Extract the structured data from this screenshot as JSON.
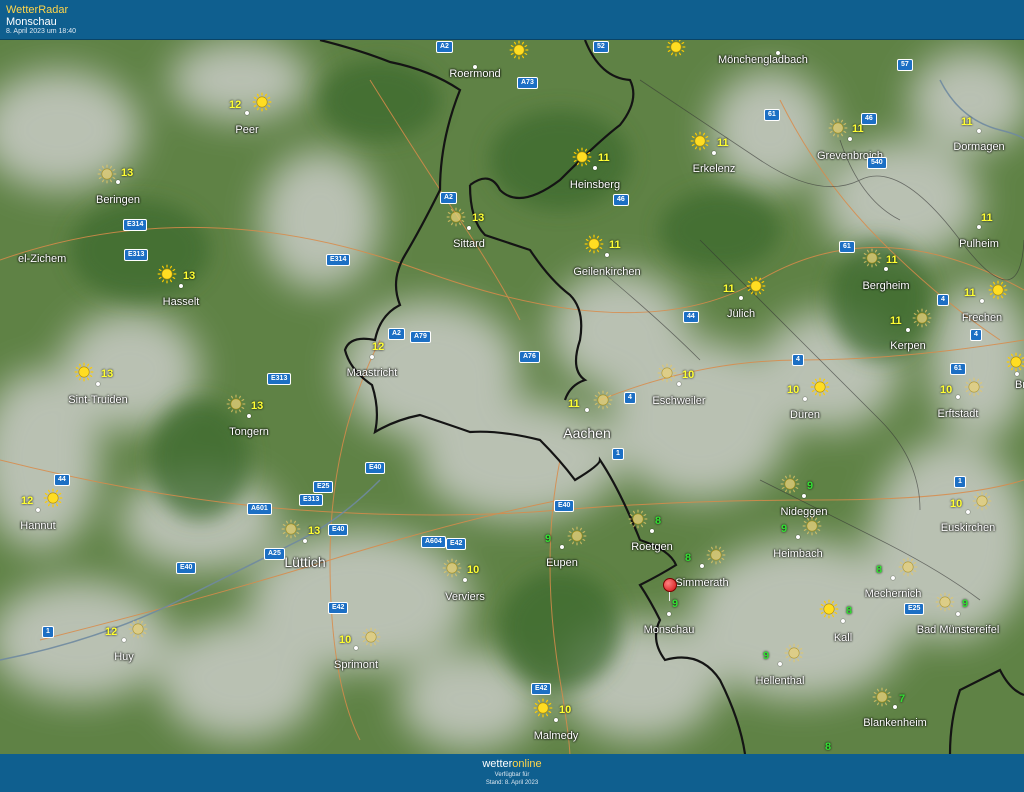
{
  "header": {
    "brand": "WetterRadar",
    "location": "Monschau",
    "timestamp": "8. April 2023 um 18:40"
  },
  "map": {
    "cities": [
      {
        "name": "Roermond",
        "temp": "",
        "weather": "sunny",
        "color": "#ffff33"
      },
      {
        "name": "Mönchengladbach",
        "temp": "",
        "weather": "sunny",
        "color": "#ffff33"
      },
      {
        "name": "Peer",
        "temp": "12",
        "weather": "sunny",
        "color": "#ffff33"
      },
      {
        "name": "Beringen",
        "temp": "13",
        "weather": "sunny-hazy",
        "color": "#ffff33"
      },
      {
        "name": "Sittard",
        "temp": "13",
        "weather": "sunny-hazy",
        "color": "#ffff33"
      },
      {
        "name": "Heinsberg",
        "temp": "11",
        "weather": "sunny",
        "color": "#ffff33"
      },
      {
        "name": "Erkelenz",
        "temp": "11",
        "weather": "sunny",
        "color": "#ffff33"
      },
      {
        "name": "Grevenbroich",
        "temp": "11",
        "weather": "sunny-hazy",
        "color": "#ffff33"
      },
      {
        "name": "Dormagen",
        "temp": "11",
        "weather": "",
        "color": "#ffff33"
      },
      {
        "name": "el-Zichem",
        "temp": "",
        "weather": "",
        "color": "#ffff33"
      },
      {
        "name": "Hasselt",
        "temp": "13",
        "weather": "sunny",
        "color": "#ffff33"
      },
      {
        "name": "Geilenkirchen",
        "temp": "11",
        "weather": "sunny",
        "color": "#ffff33"
      },
      {
        "name": "Pulheim",
        "temp": "11",
        "weather": "",
        "color": "#ffff33"
      },
      {
        "name": "Bergheim",
        "temp": "11",
        "weather": "sunny-hazy",
        "color": "#ffff33"
      },
      {
        "name": "Jülich",
        "temp": "11",
        "weather": "sunny",
        "color": "#ffff33"
      },
      {
        "name": "Frechen",
        "temp": "11",
        "weather": "sunny",
        "color": "#ffff33"
      },
      {
        "name": "Maastricht",
        "temp": "12",
        "weather": "",
        "color": "#ffff33"
      },
      {
        "name": "Kerpen",
        "temp": "11",
        "weather": "sunny-hazy",
        "color": "#ffff33"
      },
      {
        "name": "Sint-Truiden",
        "temp": "13",
        "weather": "sunny",
        "color": "#ffff33"
      },
      {
        "name": "Eschweiler",
        "temp": "10",
        "weather": "sunny-hazy",
        "color": "#ffff33"
      },
      {
        "name": "Düren",
        "temp": "10",
        "weather": "sunny",
        "color": "#ffff33"
      },
      {
        "name": "Tongern",
        "temp": "13",
        "weather": "sunny-hazy",
        "color": "#ffff33"
      },
      {
        "name": "Aachen",
        "temp": "11",
        "weather": "sunny-hazy",
        "color": "#ffff33"
      },
      {
        "name": "Erftstadt",
        "temp": "10",
        "weather": "sunny-hazy",
        "color": "#ffff33"
      },
      {
        "name": "Br",
        "temp": "",
        "weather": "sunny",
        "color": "#ffff33"
      },
      {
        "name": "Nideggen",
        "temp": "9",
        "weather": "sunny-hazy",
        "color": "#33dd33"
      },
      {
        "name": "Hannut",
        "temp": "12",
        "weather": "sunny",
        "color": "#ffff33"
      },
      {
        "name": "Euskirchen",
        "temp": "10",
        "weather": "sunny-hazy",
        "color": "#ffff33"
      },
      {
        "name": "Lüttich",
        "temp": "13",
        "weather": "sunny-hazy",
        "color": "#ffff33"
      },
      {
        "name": "Roetgen",
        "temp": "8",
        "weather": "sunny-hazy",
        "color": "#33dd33"
      },
      {
        "name": "Eupen",
        "temp": "9",
        "weather": "sunny-hazy",
        "color": "#33dd33"
      },
      {
        "name": "Heimbach",
        "temp": "9",
        "weather": "sunny-hazy",
        "color": "#33dd33"
      },
      {
        "name": "Simmerath",
        "temp": "8",
        "weather": "sunny-hazy",
        "color": "#33dd33"
      },
      {
        "name": "Verviers",
        "temp": "10",
        "weather": "sunny-hazy",
        "color": "#ffff33"
      },
      {
        "name": "Mechernich",
        "temp": "8",
        "weather": "sunny-hazy",
        "color": "#33dd33"
      },
      {
        "name": "Monschau",
        "temp": "9",
        "weather": "",
        "color": "#33dd33"
      },
      {
        "name": "Kall",
        "temp": "8",
        "weather": "sunny",
        "color": "#33dd33"
      },
      {
        "name": "Bad Münstereifel",
        "temp": "9",
        "weather": "sunny-hazy",
        "color": "#33dd33"
      },
      {
        "name": "Huy",
        "temp": "12",
        "weather": "sunny-hazy",
        "color": "#ffff33"
      },
      {
        "name": "Sprimont",
        "temp": "10",
        "weather": "sunny-hazy",
        "color": "#ffff33"
      },
      {
        "name": "Hellenthal",
        "temp": "9",
        "weather": "sunny-hazy",
        "color": "#33dd33"
      },
      {
        "name": "Blankenheim",
        "temp": "7",
        "weather": "sunny-hazy",
        "color": "#33dd33"
      },
      {
        "name": "Malmedy",
        "temp": "10",
        "weather": "sunny",
        "color": "#ffff33"
      },
      {
        "name": "",
        "temp": "8",
        "weather": "",
        "color": "#33dd33"
      }
    ],
    "roads": [
      "A2",
      "A73",
      "52",
      "57",
      "61",
      "46",
      "540",
      "A2",
      "46",
      "E314",
      "E313",
      "E314",
      "61",
      "A2",
      "A79",
      "4",
      "44",
      "A76",
      "E313",
      "4",
      "4",
      "61",
      "4",
      "1",
      "44",
      "E40",
      "E25",
      "A601",
      "E313",
      "E40",
      "A25",
      "A604",
      "E40",
      "E42",
      "E40",
      "E42",
      "E25",
      "1",
      "E42",
      "1"
    ],
    "selected_location": "Monschau"
  },
  "footer": {
    "logo_part1": "wetter",
    "logo_part2": "online",
    "available": "Verfügbar für  ",
    "stand": "Stand: 8. April 2023"
  }
}
